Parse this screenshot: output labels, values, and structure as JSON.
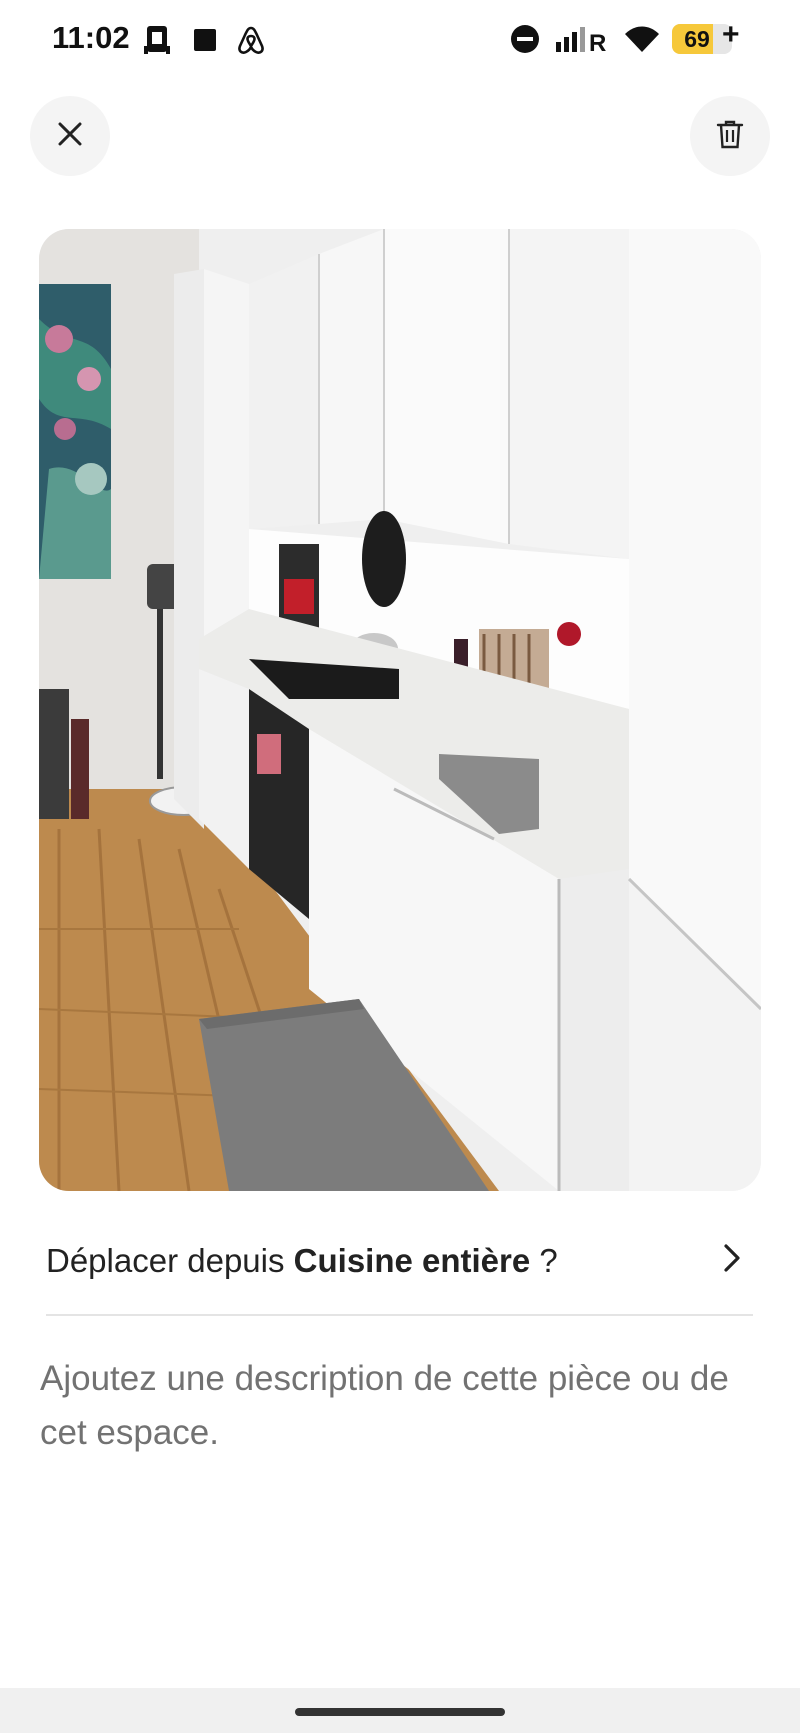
{
  "status_bar": {
    "time": "11:02",
    "battery_level": "69",
    "battery_fraction": 0.69,
    "icons": [
      "sim-card-icon",
      "square-icon",
      "airbnb-logo-icon",
      "do-not-disturb-icon",
      "signal-icon",
      "wifi-icon",
      "battery-icon",
      "charging-plus-icon"
    ]
  },
  "header": {
    "close_icon": "close-icon",
    "delete_icon": "trash-icon"
  },
  "photo": {
    "subject": "kitchen-photo"
  },
  "move_row": {
    "prefix": "Déplacer depuis ",
    "room": "Cuisine entière",
    "suffix": " ?",
    "icon": "chevron-right-icon"
  },
  "description": {
    "placeholder": "Ajoutez une description de cette pièce ou de cet espace."
  },
  "colors": {
    "text_primary": "#222222",
    "text_secondary": "#727272",
    "button_bg": "#f4f4f4",
    "divider": "#e4e4e4",
    "battery_fill": "#f6c83a"
  }
}
